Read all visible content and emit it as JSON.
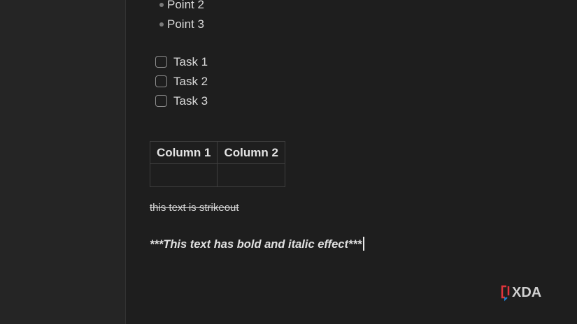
{
  "document": {
    "bullets": [
      {
        "text": "Point 2"
      },
      {
        "text": "Point 3"
      }
    ],
    "tasks": [
      {
        "text": "Task 1",
        "checked": false
      },
      {
        "text": "Task 2",
        "checked": false
      },
      {
        "text": "Task 3",
        "checked": false
      }
    ],
    "table": {
      "headers": [
        "Column 1",
        "Column 2"
      ],
      "rows": [
        [
          "",
          ""
        ]
      ]
    },
    "strikeout_text": "this text is strikeout",
    "bold_italic_text": "***This text has bold and italic effect***"
  },
  "watermark": {
    "text": "XDA",
    "accent_red": "#e0343c",
    "accent_blue": "#1f7fd0",
    "text_color": "#d0d0d0"
  }
}
